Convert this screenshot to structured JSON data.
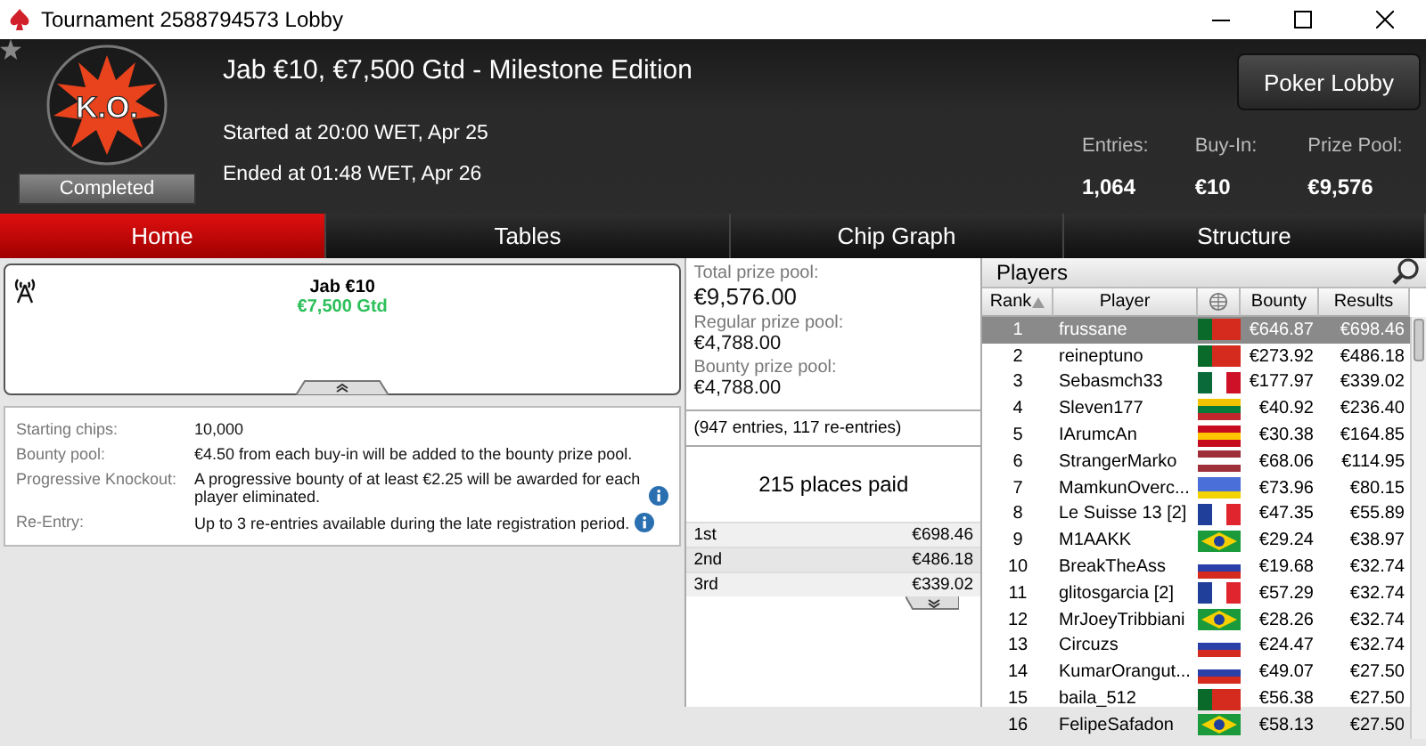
{
  "window": {
    "title": "Tournament 2588794573 Lobby"
  },
  "header": {
    "title": "Jab €10, €7,500 Gtd - Milestone Edition",
    "status": "Completed",
    "started": "Started at 20:00 WET, Apr 25",
    "ended": "Ended at 01:48 WET, Apr 26",
    "logo_text": "K.O.",
    "button": "Poker Lobby",
    "stats": [
      {
        "label": "Entries:",
        "value": "1,064"
      },
      {
        "label": "Buy-In:",
        "value": "€10"
      },
      {
        "label": "Prize Pool:",
        "value": "€9,576"
      }
    ]
  },
  "tabs": [
    {
      "label": "Home",
      "selected": true
    },
    {
      "label": "Tables",
      "selected": false
    },
    {
      "label": "Chip Graph",
      "selected": false
    },
    {
      "label": "Structure",
      "selected": false
    }
  ],
  "summary": {
    "name": "Jab €10",
    "guarantee": "€7,500 Gtd"
  },
  "details": [
    {
      "label": "Starting chips:",
      "value": "10,000",
      "info": false
    },
    {
      "label": "Bounty pool:",
      "value": "€4.50 from each buy-in will be added to the bounty prize pool.",
      "info": false
    },
    {
      "label": "Progressive Knockout:",
      "value": "A progressive bounty of at least €2.25 will be awarded for each player eliminated.",
      "info": true
    },
    {
      "label": "Re-Entry:",
      "value": "Up to 3 re-entries available during the late registration period.",
      "info": true
    }
  ],
  "prizes": {
    "pools": [
      {
        "label": "Total prize pool:",
        "value": "€9,576.00"
      },
      {
        "label": "Regular prize pool:",
        "value": "€4,788.00"
      },
      {
        "label": "Bounty prize pool:",
        "value": "€4,788.00"
      }
    ],
    "entries_note": "(947 entries, 117 re-entries)",
    "places_paid": "215 places paid",
    "payouts": [
      {
        "place": "1st",
        "amount": "€698.46"
      },
      {
        "place": "2nd",
        "amount": "€486.18"
      },
      {
        "place": "3rd",
        "amount": "€339.02"
      }
    ]
  },
  "players": {
    "title": "Players",
    "columns": [
      "Rank",
      "Player",
      "Bounty",
      "Results"
    ],
    "rows": [
      {
        "rank": "1",
        "player": "frussane",
        "kind": "pt",
        "bounty": "€646.87",
        "result": "€698.46",
        "selected": true
      },
      {
        "rank": "2",
        "player": "reineptuno",
        "kind": "pt",
        "bounty": "€273.92",
        "result": "€486.18",
        "selected": false
      },
      {
        "rank": "3",
        "player": "Sebasmch33",
        "kind": "mx",
        "bounty": "€177.97",
        "result": "€339.02",
        "selected": false
      },
      {
        "rank": "4",
        "player": "Sleven177",
        "kind": "lt",
        "bounty": "€40.92",
        "result": "€236.40",
        "selected": false
      },
      {
        "rank": "5",
        "player": "IArumcAn",
        "kind": "es",
        "bounty": "€30.38",
        "result": "€164.85",
        "selected": false
      },
      {
        "rank": "6",
        "player": "StrangerMarko",
        "kind": "lv",
        "bounty": "€68.06",
        "result": "€114.95",
        "selected": false
      },
      {
        "rank": "7",
        "player": "MamkunOverc...",
        "kind": "ua",
        "bounty": "€73.96",
        "result": "€80.15",
        "selected": false
      },
      {
        "rank": "8",
        "player": "Le Suisse 13 [2]",
        "kind": "fr",
        "bounty": "€47.35",
        "result": "€55.89",
        "selected": false
      },
      {
        "rank": "9",
        "player": "M1AAKK",
        "kind": "br",
        "bounty": "€29.24",
        "result": "€38.97",
        "selected": false
      },
      {
        "rank": "10",
        "player": "BreakTheAss",
        "kind": "ru",
        "bounty": "€19.68",
        "result": "€32.74",
        "selected": false
      },
      {
        "rank": "11",
        "player": "glitosgarcia [2]",
        "kind": "fr",
        "bounty": "€57.29",
        "result": "€32.74",
        "selected": false
      },
      {
        "rank": "12",
        "player": "MrJoeyTribbiani",
        "kind": "br",
        "bounty": "€28.26",
        "result": "€32.74",
        "selected": false
      },
      {
        "rank": "13",
        "player": "Circuzs",
        "kind": "ru",
        "bounty": "€24.47",
        "result": "€32.74",
        "selected": false
      },
      {
        "rank": "14",
        "player": "KumarOrangut...",
        "kind": "ru",
        "bounty": "€49.07",
        "result": "€27.50",
        "selected": false
      },
      {
        "rank": "15",
        "player": "baila_512",
        "kind": "pt",
        "bounty": "€56.38",
        "result": "€27.50",
        "selected": false
      },
      {
        "rank": "16",
        "player": "FelipeSafadon",
        "kind": "br",
        "bounty": "€58.13",
        "result": "€27.50",
        "selected": false
      }
    ]
  }
}
